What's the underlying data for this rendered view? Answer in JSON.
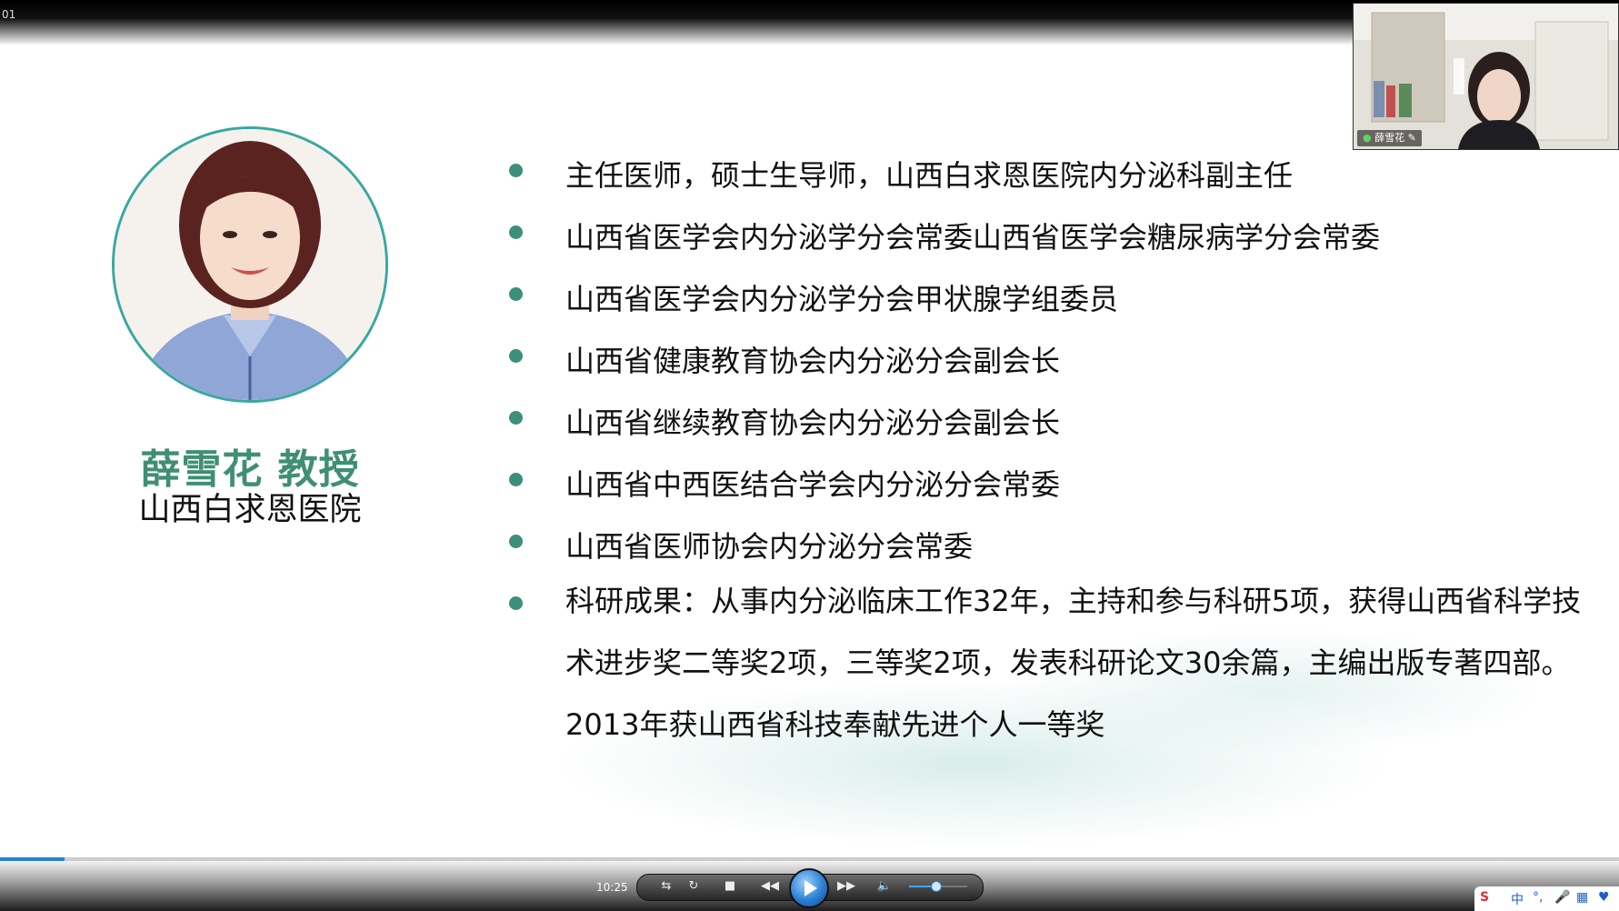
{
  "top": {
    "corner_label": "01"
  },
  "presenter": {
    "name": "薛雪花 教授",
    "hospital": "山西白求恩医院"
  },
  "bullets": [
    "主任医师，硕士生导师，山西白求恩医院内分泌科副主任",
    "山西省医学会内分泌学分会常委山西省医学会糖尿病学分会常委",
    "山西省医学会内分泌学分会甲状腺学组委员",
    "山西省健康教育协会内分泌分会副会长",
    "山西省继续教育协会内分泌分会副会长",
    "山西省中西医结合学会内分泌分会常委",
    "山西省医师协会内分泌分会常委",
    "科研成果：从事内分泌临床工作32年，主持和参与科研5项，获得山西省科学技术进步奖二等奖2项，三等奖2项，发表科研论文30余篇，主编出版专著四部。2013年获山西省科技奉献先进个人一等奖"
  ],
  "webcam": {
    "participant_name": "薛雪花"
  },
  "player": {
    "time": "10:25",
    "progress_fraction": 0.04,
    "volume_fraction": 0.45
  },
  "tray": {
    "ime_label": "中"
  },
  "colors": {
    "accent_green": "#3f8f73",
    "bullet_dot": "#3d8f7c",
    "portrait_ring": "#3aa8a1",
    "player_blue": "#2a7fd4"
  }
}
